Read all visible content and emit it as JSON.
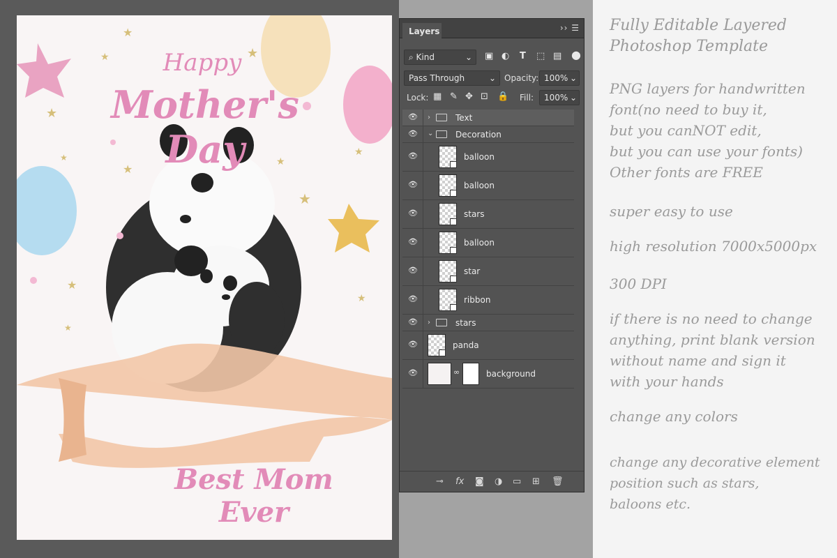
{
  "card": {
    "line1": "Happy",
    "line2": "Mother's Day",
    "footer": "Best Mom Ever",
    "colors": {
      "accent": "#e28bb8",
      "background": "#f9f5f5",
      "ribbon": "#f2c7a7",
      "star": "#d6bf7a",
      "pink_balloon": "#f2a9c8",
      "blue_balloon": "#a9d7ee",
      "cream_balloon": "#f5dfb5"
    }
  },
  "panel": {
    "tab_label": "Layers",
    "filter_label": "Kind",
    "blend_mode": "Pass Through",
    "opacity_label": "Opacity:",
    "opacity_value": "100%",
    "lock_label": "Lock:",
    "fill_label": "Fill:",
    "fill_value": "100%",
    "layers": [
      {
        "name": "Text",
        "type": "group"
      },
      {
        "name": "Decoration",
        "type": "group-open"
      },
      {
        "name": "balloon",
        "type": "layer"
      },
      {
        "name": "balloon",
        "type": "layer"
      },
      {
        "name": "stars",
        "type": "layer"
      },
      {
        "name": "balloon",
        "type": "layer"
      },
      {
        "name": "star",
        "type": "layer"
      },
      {
        "name": "ribbon",
        "type": "layer"
      },
      {
        "name": "stars",
        "type": "group"
      },
      {
        "name": "panda",
        "type": "layer"
      },
      {
        "name": "background",
        "type": "layer-mask"
      }
    ]
  },
  "description": {
    "d1": "Fully Editable Layered\nPhotoshop Template",
    "d2": "PNG layers for handwritten\nfont(no need to buy it,\nbut you canNOT edit,\nbut you can use your fonts)\nOther fonts are FREE",
    "d3": "super easy to use",
    "d4": "high resolution 7000x5000px",
    "d5": "300 DPI",
    "d6": "if there is no need to change\nanything, print blank version\nwithout name and sign it\nwith your hands",
    "d7": "change any colors",
    "d8": "change any decorative element\nposition such as stars,\nbaloons etc."
  }
}
